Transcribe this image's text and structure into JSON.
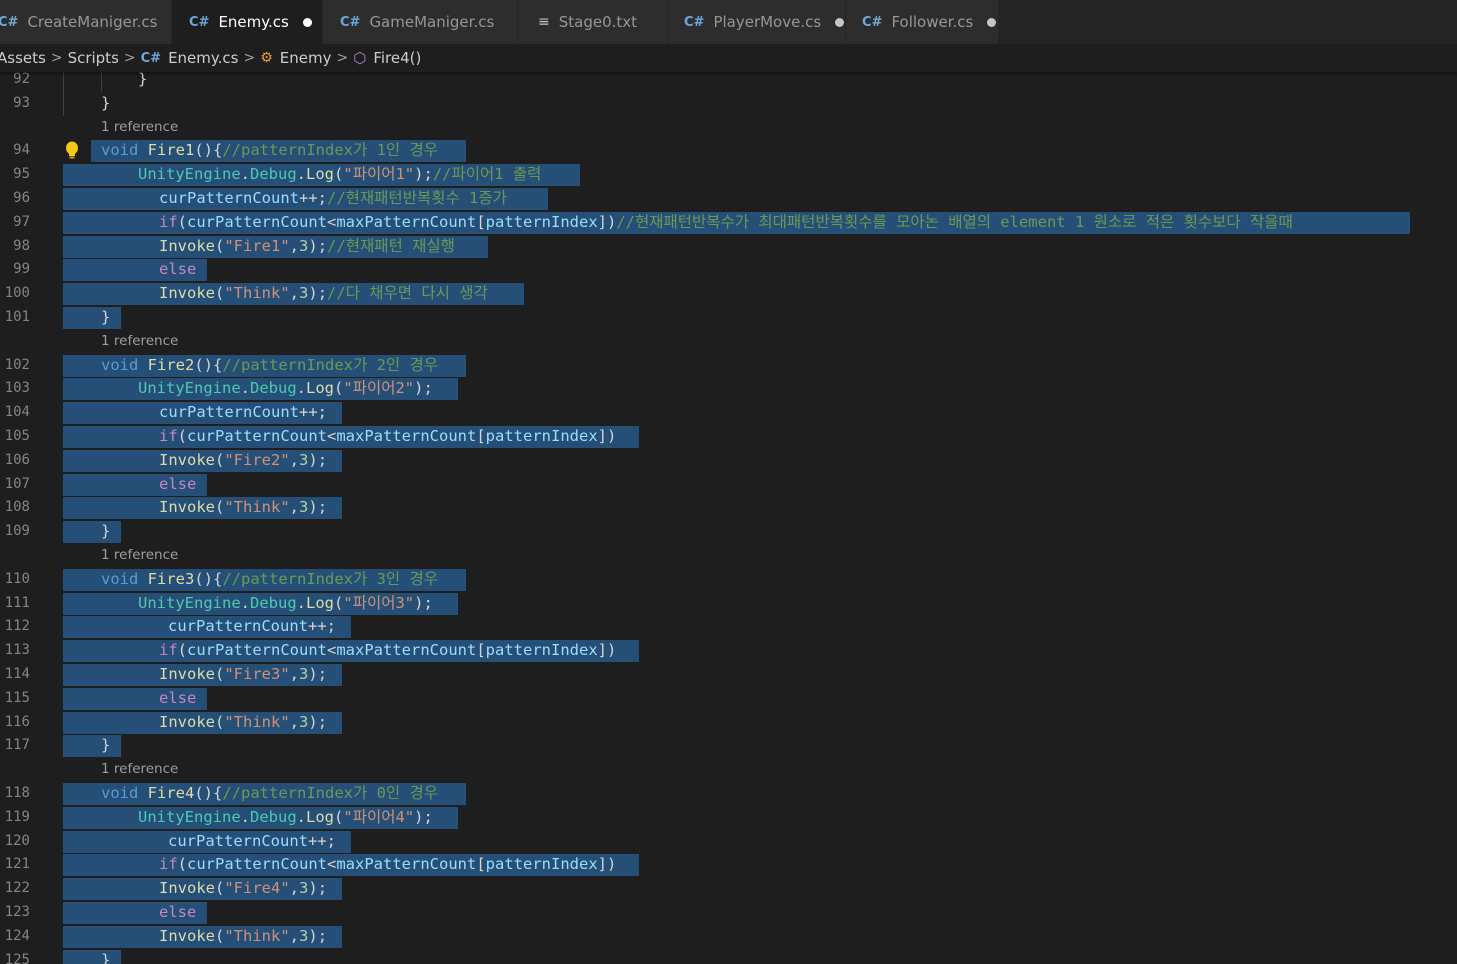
{
  "tabs": [
    {
      "label": "CreateManiger.cs",
      "icon": "csharp-icon",
      "active": false,
      "dirty": false
    },
    {
      "label": "Enemy.cs",
      "icon": "csharp-icon",
      "active": true,
      "dirty": true
    },
    {
      "label": "GameManiger.cs",
      "icon": "csharp-icon",
      "active": false,
      "dirty": false
    },
    {
      "label": "Stage0.txt",
      "icon": "text-file-icon",
      "active": false,
      "dirty": false
    },
    {
      "label": "PlayerMove.cs",
      "icon": "csharp-icon",
      "active": false,
      "dirty": true
    },
    {
      "label": "Follower.cs",
      "icon": "csharp-icon",
      "active": false,
      "dirty": true
    }
  ],
  "breadcrumb": {
    "items": [
      "Assets",
      "Scripts",
      "Enemy.cs",
      "Enemy",
      "Fire4()"
    ],
    "icons": [
      "",
      "",
      "csharp-icon",
      "class-icon",
      "method-icon"
    ]
  },
  "code_lens_label": "1 reference",
  "colors": {
    "background": "#1e1e1e",
    "selection": "#264f78",
    "keyword": "#569cd6",
    "control": "#c586c0",
    "function": "#dcdcaa",
    "string": "#ce9178",
    "comment": "#6a9955",
    "variable": "#9cdcfe",
    "type": "#4ec9b0"
  },
  "lines": [
    {
      "n": "92",
      "tokens": [
        [
          "pl",
          "}"
        ]
      ]
    },
    {
      "n": "93",
      "tokens": [
        [
          "pl",
          "}"
        ]
      ]
    },
    {
      "lens": true
    },
    {
      "n": "94",
      "bulb": true,
      "tokens": [
        [
          "kw",
          "void"
        ],
        [
          "pl",
          " "
        ],
        [
          "fn",
          "Fire1"
        ],
        [
          "pl",
          "(){"
        ],
        [
          "cm",
          "//patternIndex가 1인 경우"
        ]
      ]
    },
    {
      "n": "95",
      "tokens": [
        [
          "ty",
          "UnityEngine"
        ],
        [
          "pl",
          "."
        ],
        [
          "ty",
          "Debug"
        ],
        [
          "pl",
          "."
        ],
        [
          "fn",
          "Log"
        ],
        [
          "pl",
          "("
        ],
        [
          "str",
          "\"파이어1\""
        ],
        [
          "pl",
          ");"
        ],
        [
          "cm",
          "//파이어1 출력"
        ]
      ]
    },
    {
      "n": "96",
      "tokens": [
        [
          "vr",
          "curPatternCount"
        ],
        [
          "pl",
          "++;"
        ],
        [
          "cm",
          "//현재패턴반복횟수 1증가"
        ]
      ]
    },
    {
      "n": "97",
      "tokens": [
        [
          "cf",
          "if"
        ],
        [
          "pl",
          "("
        ],
        [
          "vr",
          "curPatternCount"
        ],
        [
          "pl",
          "<"
        ],
        [
          "vr",
          "maxPatternCount"
        ],
        [
          "pl",
          "["
        ],
        [
          "vr",
          "patternIndex"
        ],
        [
          "pl",
          "])"
        ],
        [
          "cm",
          "//현재패턴반복수가 최대패턴반복횟수를 모아논 배열의 element 1 원소로 적은 횟수보다 작을때"
        ]
      ]
    },
    {
      "n": "98",
      "tokens": [
        [
          "fn",
          "Invoke"
        ],
        [
          "pl",
          "("
        ],
        [
          "str",
          "\"Fire1\""
        ],
        [
          "pl",
          ","
        ],
        [
          "nm",
          "3"
        ],
        [
          "pl",
          ");"
        ],
        [
          "cm",
          "//현재패턴 재실행"
        ]
      ]
    },
    {
      "n": "99",
      "tokens": [
        [
          "cf",
          "else"
        ]
      ]
    },
    {
      "n": "100",
      "tokens": [
        [
          "fn",
          "Invoke"
        ],
        [
          "pl",
          "("
        ],
        [
          "str",
          "\"Think\""
        ],
        [
          "pl",
          ","
        ],
        [
          "nm",
          "3"
        ],
        [
          "pl",
          ");"
        ],
        [
          "cm",
          "//다 채우면 다시 생각"
        ]
      ]
    },
    {
      "n": "101",
      "tokens": [
        [
          "pl",
          "}"
        ]
      ]
    },
    {
      "lens": true
    },
    {
      "n": "102",
      "tokens": [
        [
          "kw",
          "void"
        ],
        [
          "pl",
          " "
        ],
        [
          "fn",
          "Fire2"
        ],
        [
          "pl",
          "(){"
        ],
        [
          "cm",
          "//patternIndex가 2인 경우"
        ]
      ]
    },
    {
      "n": "103",
      "tokens": [
        [
          "ty",
          "UnityEngine"
        ],
        [
          "pl",
          "."
        ],
        [
          "ty",
          "Debug"
        ],
        [
          "pl",
          "."
        ],
        [
          "fn",
          "Log"
        ],
        [
          "pl",
          "("
        ],
        [
          "str",
          "\"파이어2\""
        ],
        [
          "pl",
          ");"
        ]
      ]
    },
    {
      "n": "104",
      "tokens": [
        [
          "vr",
          "curPatternCount"
        ],
        [
          "pl",
          "++;"
        ]
      ]
    },
    {
      "n": "105",
      "tokens": [
        [
          "cf",
          "if"
        ],
        [
          "pl",
          "("
        ],
        [
          "vr",
          "curPatternCount"
        ],
        [
          "pl",
          "<"
        ],
        [
          "vr",
          "maxPatternCount"
        ],
        [
          "pl",
          "["
        ],
        [
          "vr",
          "patternIndex"
        ],
        [
          "pl",
          "])"
        ]
      ]
    },
    {
      "n": "106",
      "tokens": [
        [
          "fn",
          "Invoke"
        ],
        [
          "pl",
          "("
        ],
        [
          "str",
          "\"Fire2\""
        ],
        [
          "pl",
          ","
        ],
        [
          "nm",
          "3"
        ],
        [
          "pl",
          ");"
        ]
      ]
    },
    {
      "n": "107",
      "tokens": [
        [
          "cf",
          "else"
        ]
      ]
    },
    {
      "n": "108",
      "tokens": [
        [
          "fn",
          "Invoke"
        ],
        [
          "pl",
          "("
        ],
        [
          "str",
          "\"Think\""
        ],
        [
          "pl",
          ","
        ],
        [
          "nm",
          "3"
        ],
        [
          "pl",
          ");"
        ]
      ]
    },
    {
      "n": "109",
      "tokens": [
        [
          "pl",
          "}"
        ]
      ]
    },
    {
      "lens": true
    },
    {
      "n": "110",
      "tokens": [
        [
          "kw",
          "void"
        ],
        [
          "pl",
          " "
        ],
        [
          "fn",
          "Fire3"
        ],
        [
          "pl",
          "(){"
        ],
        [
          "cm",
          "//patternIndex가 3인 경우"
        ]
      ]
    },
    {
      "n": "111",
      "tokens": [
        [
          "ty",
          "UnityEngine"
        ],
        [
          "pl",
          "."
        ],
        [
          "ty",
          "Debug"
        ],
        [
          "pl",
          "."
        ],
        [
          "fn",
          "Log"
        ],
        [
          "pl",
          "("
        ],
        [
          "str",
          "\"파이어3\""
        ],
        [
          "pl",
          ");"
        ]
      ]
    },
    {
      "n": "112",
      "tokens": [
        [
          "vr",
          "curPatternCount"
        ],
        [
          "pl",
          "++;"
        ]
      ]
    },
    {
      "n": "113",
      "tokens": [
        [
          "cf",
          "if"
        ],
        [
          "pl",
          "("
        ],
        [
          "vr",
          "curPatternCount"
        ],
        [
          "pl",
          "<"
        ],
        [
          "vr",
          "maxPatternCount"
        ],
        [
          "pl",
          "["
        ],
        [
          "vr",
          "patternIndex"
        ],
        [
          "pl",
          "])"
        ]
      ]
    },
    {
      "n": "114",
      "tokens": [
        [
          "fn",
          "Invoke"
        ],
        [
          "pl",
          "("
        ],
        [
          "str",
          "\"Fire3\""
        ],
        [
          "pl",
          ","
        ],
        [
          "nm",
          "3"
        ],
        [
          "pl",
          ");"
        ]
      ]
    },
    {
      "n": "115",
      "tokens": [
        [
          "cf",
          "else"
        ]
      ]
    },
    {
      "n": "116",
      "tokens": [
        [
          "fn",
          "Invoke"
        ],
        [
          "pl",
          "("
        ],
        [
          "str",
          "\"Think\""
        ],
        [
          "pl",
          ","
        ],
        [
          "nm",
          "3"
        ],
        [
          "pl",
          ");"
        ]
      ]
    },
    {
      "n": "117",
      "tokens": [
        [
          "pl",
          "}"
        ]
      ]
    },
    {
      "lens": true
    },
    {
      "n": "118",
      "tokens": [
        [
          "kw",
          "void"
        ],
        [
          "pl",
          " "
        ],
        [
          "fn",
          "Fire4"
        ],
        [
          "pl",
          "(){"
        ],
        [
          "cm",
          "//patternIndex가 0인 경우"
        ]
      ]
    },
    {
      "n": "119",
      "tokens": [
        [
          "ty",
          "UnityEngine"
        ],
        [
          "pl",
          "."
        ],
        [
          "ty",
          "Debug"
        ],
        [
          "pl",
          "."
        ],
        [
          "fn",
          "Log"
        ],
        [
          "pl",
          "("
        ],
        [
          "str",
          "\"파이어4\""
        ],
        [
          "pl",
          ");"
        ]
      ]
    },
    {
      "n": "120",
      "tokens": [
        [
          "vr",
          "curPatternCount"
        ],
        [
          "pl",
          "++;"
        ]
      ]
    },
    {
      "n": "121",
      "tokens": [
        [
          "cf",
          "if"
        ],
        [
          "pl",
          "("
        ],
        [
          "vr",
          "curPatternCount"
        ],
        [
          "pl",
          "<"
        ],
        [
          "vr",
          "maxPatternCount"
        ],
        [
          "pl",
          "["
        ],
        [
          "vr",
          "patternIndex"
        ],
        [
          "pl",
          "])"
        ]
      ]
    },
    {
      "n": "122",
      "tokens": [
        [
          "fn",
          "Invoke"
        ],
        [
          "pl",
          "("
        ],
        [
          "str",
          "\"Fire4\""
        ],
        [
          "pl",
          ","
        ],
        [
          "nm",
          "3"
        ],
        [
          "pl",
          ");"
        ]
      ]
    },
    {
      "n": "123",
      "tokens": [
        [
          "cf",
          "else"
        ]
      ]
    },
    {
      "n": "124",
      "tokens": [
        [
          "fn",
          "Invoke"
        ],
        [
          "pl",
          "("
        ],
        [
          "str",
          "\"Think\""
        ],
        [
          "pl",
          ","
        ],
        [
          "nm",
          "3"
        ],
        [
          "pl",
          ");"
        ]
      ]
    },
    {
      "n": "125",
      "tokens": [
        [
          "pl",
          "}"
        ]
      ]
    }
  ]
}
